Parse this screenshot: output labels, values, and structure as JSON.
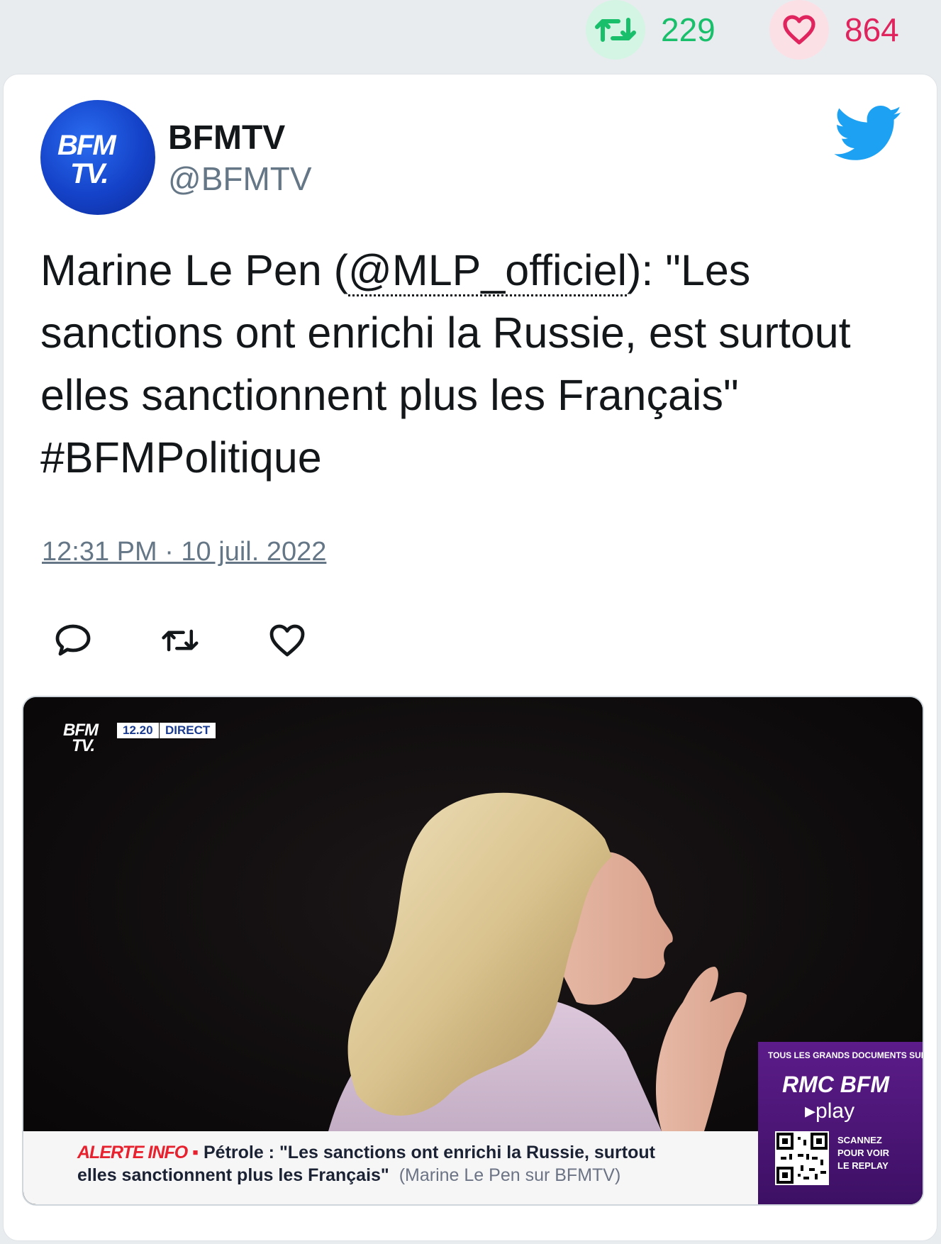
{
  "stats": {
    "retweets": "229",
    "likes": "864"
  },
  "tweet": {
    "author_name": "BFMTV",
    "author_handle": "@BFMTV",
    "avatar_logo_line1": "BFM",
    "avatar_logo_line2": "TV.",
    "text_before": "Marine Le Pen (",
    "mention": "@MLP_officiel",
    "text_after": "): \"Les sanctions ont enrichi la Russie, est surtout elles sanctionnent plus les Français\" #BFMPolitique",
    "timestamp": "12:31 PM · 10 juil. 2022"
  },
  "icons": {
    "retweet_stat": "retweet-icon",
    "like_stat": "heart-icon",
    "twitter": "twitter-bird-icon",
    "reply": "reply-icon",
    "retweet": "retweet-icon",
    "like": "heart-icon"
  },
  "media": {
    "channel_logo_line1": "BFM",
    "channel_logo_line2": "TV.",
    "clock": "12.20",
    "live_label": "DIRECT",
    "ticker_alert": "ALERTE INFO",
    "ticker_line1": "Pétrole : \"Les sanctions ont enrichi la Russie, surtout",
    "ticker_line2": "elles sanctionnent plus les Français\"",
    "ticker_source": "(Marine Le Pen sur BFMTV)",
    "promo_top": "TOUS LES GRANDS DOCUMENTS SUR",
    "promo_brand": "RMC BFM",
    "promo_play": "▸play",
    "promo_scan_1": "SCANNEZ",
    "promo_scan_2": "POUR VOIR",
    "promo_scan_3": "LE REPLAY"
  },
  "colors": {
    "retweet_green": "#19bf6b",
    "like_pink": "#e0245e",
    "twitter_blue": "#1da1f2",
    "bfm_blue": "#1442c8",
    "alert_red": "#e8212e",
    "promo_purple": "#5c1c8a"
  }
}
